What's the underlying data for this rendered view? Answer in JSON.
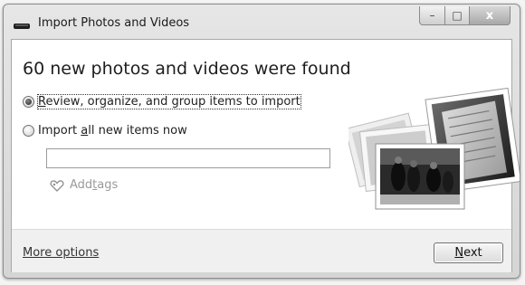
{
  "window": {
    "title": "Import Photos and Videos",
    "caption": {
      "minimize": "–",
      "maximize": "□",
      "close": "x"
    }
  },
  "main": {
    "heading": "60 new photos and videos were found",
    "options": [
      {
        "label_before": "",
        "mnemonic": "R",
        "label_after": "eview, organize, and group items to import",
        "selected": true
      },
      {
        "label_before": "Import ",
        "mnemonic": "a",
        "label_after": "ll new items now",
        "selected": false
      }
    ],
    "tags_input": {
      "value": "",
      "placeholder": ""
    },
    "add_tags": {
      "before": "Add ",
      "mnemonic": "t",
      "after": "ags"
    }
  },
  "footer": {
    "more_options": "More options",
    "next": {
      "before": "",
      "mnemonic": "N",
      "after": "ext"
    }
  }
}
